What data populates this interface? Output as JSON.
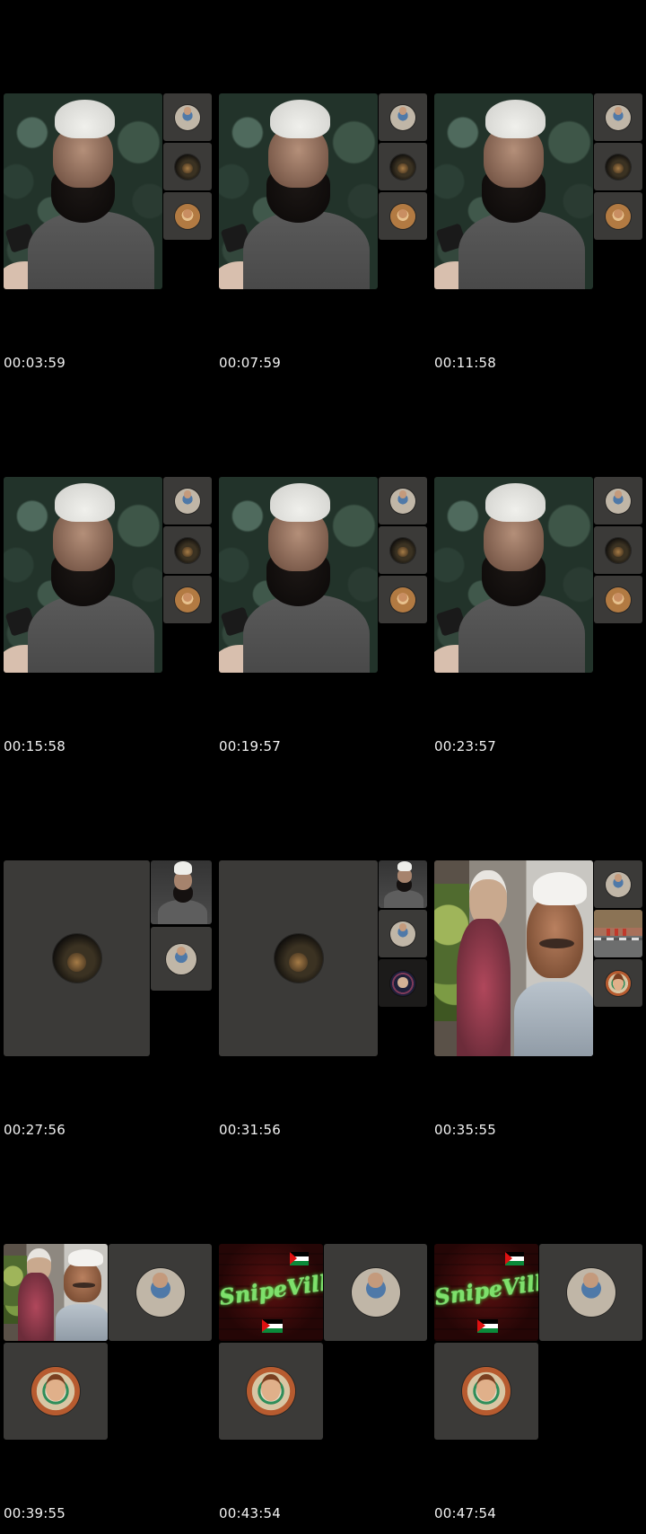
{
  "timestamps": [
    "00:03:59",
    "00:07:59",
    "00:11:58",
    "00:15:58",
    "00:19:57",
    "00:23:57",
    "00:27:56",
    "00:31:56",
    "00:35:55",
    "00:39:55",
    "00:43:54",
    "00:47:54"
  ],
  "logo_texts": {
    "snipeville": "SnipeVille"
  },
  "colors": {
    "background": "#000000",
    "tile": "#3b3a38",
    "timestamp_text": "#f2f2f2",
    "neon_green": "#7ee06b"
  }
}
